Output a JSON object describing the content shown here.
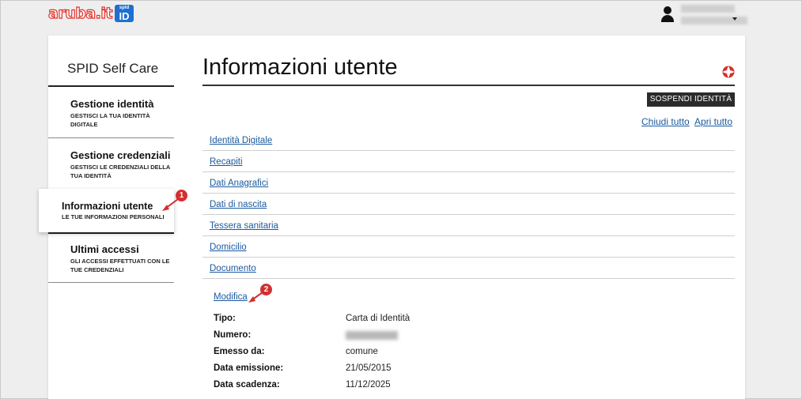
{
  "header": {
    "logo_text": "aruba.it",
    "spid_small": "spid",
    "spid_id": "ID"
  },
  "sidebar": {
    "title": "SPID Self Care",
    "items": [
      {
        "label": "Gestione identità",
        "sub": "GESTISCI LA TUA IDENTITÀ DIGITALE"
      },
      {
        "label": "Gestione credenziali",
        "sub": "GESTISCI LE CREDENZIALI DELLA TUA IDENTITÀ"
      },
      {
        "label": "Informazioni utente",
        "sub": "LE TUE INFORMAZIONI PERSONALI"
      },
      {
        "label": "Ultimi accessi",
        "sub": "GLI ACCESSI EFFETTUATI CON LE TUE CREDENZIALI"
      }
    ]
  },
  "main": {
    "title": "Informazioni utente",
    "suspend_button": "SOSPENDI IDENTITÀ",
    "close_all": "Chiudi tutto",
    "open_all": "Apri tutto",
    "sections": [
      "Identità Digitale",
      "Recapiti",
      "Dati Anagrafici",
      "Dati di nascita",
      "Tessera sanitaria",
      "Domicilio",
      "Documento"
    ],
    "document": {
      "edit_link": "Modifica",
      "fields": [
        {
          "label": "Tipo:",
          "value": "Carta di Identità"
        },
        {
          "label": "Numero:",
          "value": ""
        },
        {
          "label": "Emesso da:",
          "value": "comune"
        },
        {
          "label": "Data emissione:",
          "value": "21/05/2015"
        },
        {
          "label": "Data scadenza:",
          "value": "11/12/2025"
        }
      ]
    }
  },
  "annotations": {
    "badge1": "1",
    "badge2": "2",
    "color": "#d32f2f"
  }
}
